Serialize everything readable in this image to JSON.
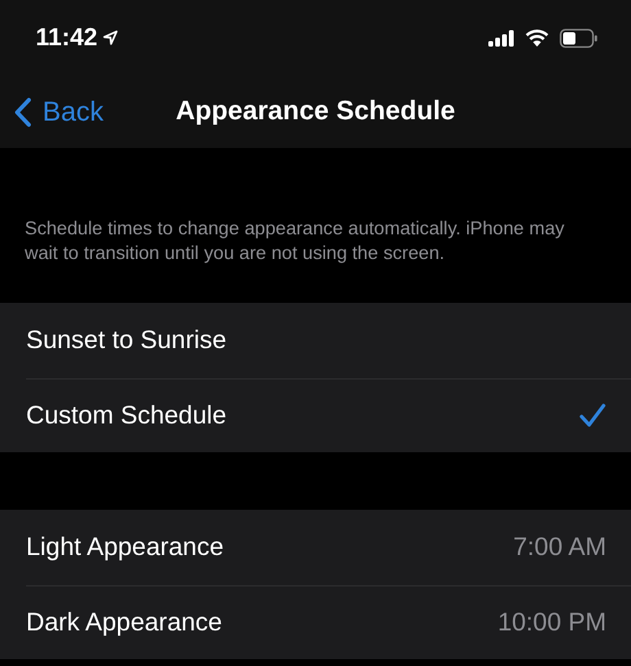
{
  "status_bar": {
    "time": "11:42"
  },
  "nav": {
    "back": "Back",
    "title": "Appearance Schedule"
  },
  "schedule_note": "Schedule times to change appearance automatically. iPhone may wait to transition until you are not using the screen.",
  "options": [
    {
      "label": "Sunset to Sunrise",
      "selected": false
    },
    {
      "label": "Custom Schedule",
      "selected": true
    }
  ],
  "times": [
    {
      "label": "Light Appearance",
      "value": "7:00 AM"
    },
    {
      "label": "Dark Appearance",
      "value": "10:00 PM"
    }
  ]
}
